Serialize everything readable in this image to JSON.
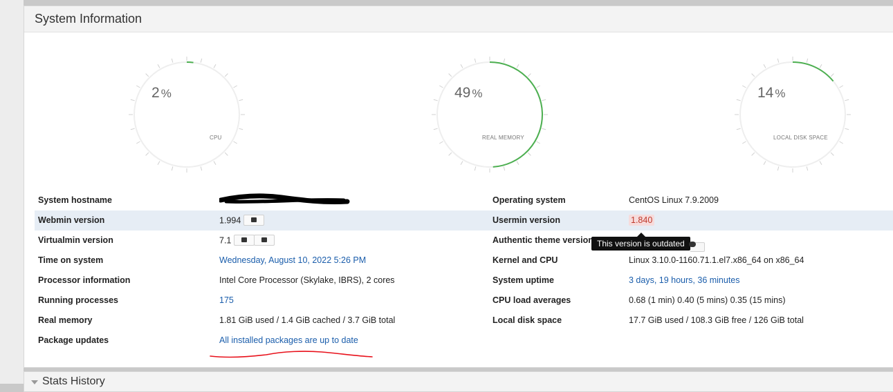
{
  "panel": {
    "title": "System Information"
  },
  "gauges": [
    {
      "value": "2",
      "unit": "%",
      "label": "CPU",
      "percent": 2
    },
    {
      "value": "49",
      "unit": "%",
      "label": "REAL MEMORY",
      "percent": 49
    },
    {
      "value": "14",
      "unit": "%",
      "label": "LOCAL DISK SPACE",
      "percent": 14
    }
  ],
  "colors": {
    "gauge_arc": "#4caf50",
    "gauge_track": "#eeeeee",
    "link": "#1a5dab",
    "highlight_row": "#e6edf5",
    "annotation_red": "#e8101a"
  },
  "rows": [
    {
      "k1": "System hostname",
      "v1": "",
      "k2": "Operating system",
      "v2": "CentOS Linux 7.9.2009"
    },
    {
      "k1": "Webmin version",
      "v1": "1.994",
      "k2": "Usermin version",
      "v2": "1.840"
    },
    {
      "k1": "Virtualmin version",
      "v1": "7.1",
      "k2": "Authentic theme version",
      "v2": ""
    },
    {
      "k1": "Time on system",
      "v1": "Wednesday, August 10, 2022 5:26 PM",
      "k2": "Kernel and CPU",
      "v2": "Linux 3.10.0-1160.71.1.el7.x86_64 on x86_64"
    },
    {
      "k1": "Processor information",
      "v1": "Intel Core Processor (Skylake, IBRS), 2 cores",
      "k2": "System uptime",
      "v2": "3 days, 19 hours, 36 minutes"
    },
    {
      "k1": "Running processes",
      "v1": "175",
      "k2": "CPU load averages",
      "v2": "0.68 (1 min) 0.40 (5 mins) 0.35 (15 mins)"
    },
    {
      "k1": "Real memory",
      "v1": "1.81 GiB used / 1.4 GiB cached / 3.7 GiB total",
      "k2": "Local disk space",
      "v2": "17.7 GiB used / 108.3 GiB free / 126 GiB total"
    },
    {
      "k1": "Package updates",
      "v1": "All installed packages are up to date",
      "k2": "",
      "v2": ""
    }
  ],
  "tooltip": {
    "text": "This version is outdated"
  },
  "stats": {
    "title": "Stats History"
  }
}
